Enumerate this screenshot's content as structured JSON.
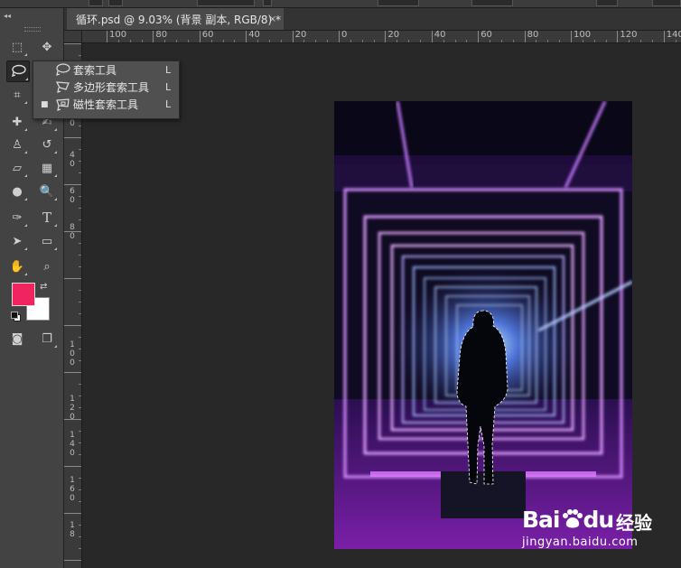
{
  "document_tab": {
    "title": "循环.psd @ 9.03% (背景 副本, RGB/8) *",
    "close_glyph": "×"
  },
  "rulers": {
    "horizontal": [
      "100",
      "80",
      "60",
      "40",
      "20",
      "0",
      "20",
      "40",
      "60",
      "80",
      "100",
      "120",
      "140"
    ],
    "vertical": [
      "2",
      "0",
      "4",
      "0",
      "6",
      "0",
      "8",
      "0",
      "1",
      "0",
      "0",
      "1",
      "2",
      "0",
      "1",
      "4",
      "0",
      "1",
      "6",
      "0",
      "1",
      "8"
    ]
  },
  "toolbar": {
    "collapse_glyph": "◂◂",
    "tools": [
      {
        "id": "marquee",
        "glyph": "⬚"
      },
      {
        "id": "move",
        "glyph": "✥"
      },
      {
        "id": "lasso",
        "glyph": "ʘ"
      },
      {
        "id": "quick-select",
        "glyph": "✎"
      },
      {
        "id": "crop",
        "glyph": "⌗"
      },
      {
        "id": "eyedropper",
        "glyph": "✒"
      },
      {
        "id": "healing",
        "glyph": "✚"
      },
      {
        "id": "brush",
        "glyph": "✍"
      },
      {
        "id": "stamp",
        "glyph": "♙"
      },
      {
        "id": "history-brush",
        "glyph": "↺"
      },
      {
        "id": "eraser",
        "glyph": "▱"
      },
      {
        "id": "gradient",
        "glyph": "▦"
      },
      {
        "id": "blur",
        "glyph": "●"
      },
      {
        "id": "dodge",
        "glyph": "🔍"
      },
      {
        "id": "pen",
        "glyph": "✑"
      },
      {
        "id": "type",
        "glyph": "T"
      },
      {
        "id": "path-select",
        "glyph": "➤"
      },
      {
        "id": "shape",
        "glyph": "▭"
      },
      {
        "id": "hand",
        "glyph": "✋"
      },
      {
        "id": "zoom",
        "glyph": "⌕"
      },
      {
        "id": "quick-mask",
        "glyph": "◙"
      },
      {
        "id": "screen-mode",
        "glyph": "❐"
      }
    ],
    "foreground_color": "#f0245f",
    "background_color": "#ffffff",
    "swap_glyph": "⇄"
  },
  "flyout": {
    "items": [
      {
        "label": "套索工具",
        "shortcut": "L",
        "selected": false
      },
      {
        "label": "多边形套索工具",
        "shortcut": "L",
        "selected": false
      },
      {
        "label": "磁性套索工具",
        "shortcut": "L",
        "selected": true
      }
    ],
    "selected_marker": "■"
  },
  "watermark": {
    "brand_text": "Bai",
    "brand_text2": "du",
    "jingyan_text": "经验",
    "url": "jingyan.baidu.com"
  }
}
